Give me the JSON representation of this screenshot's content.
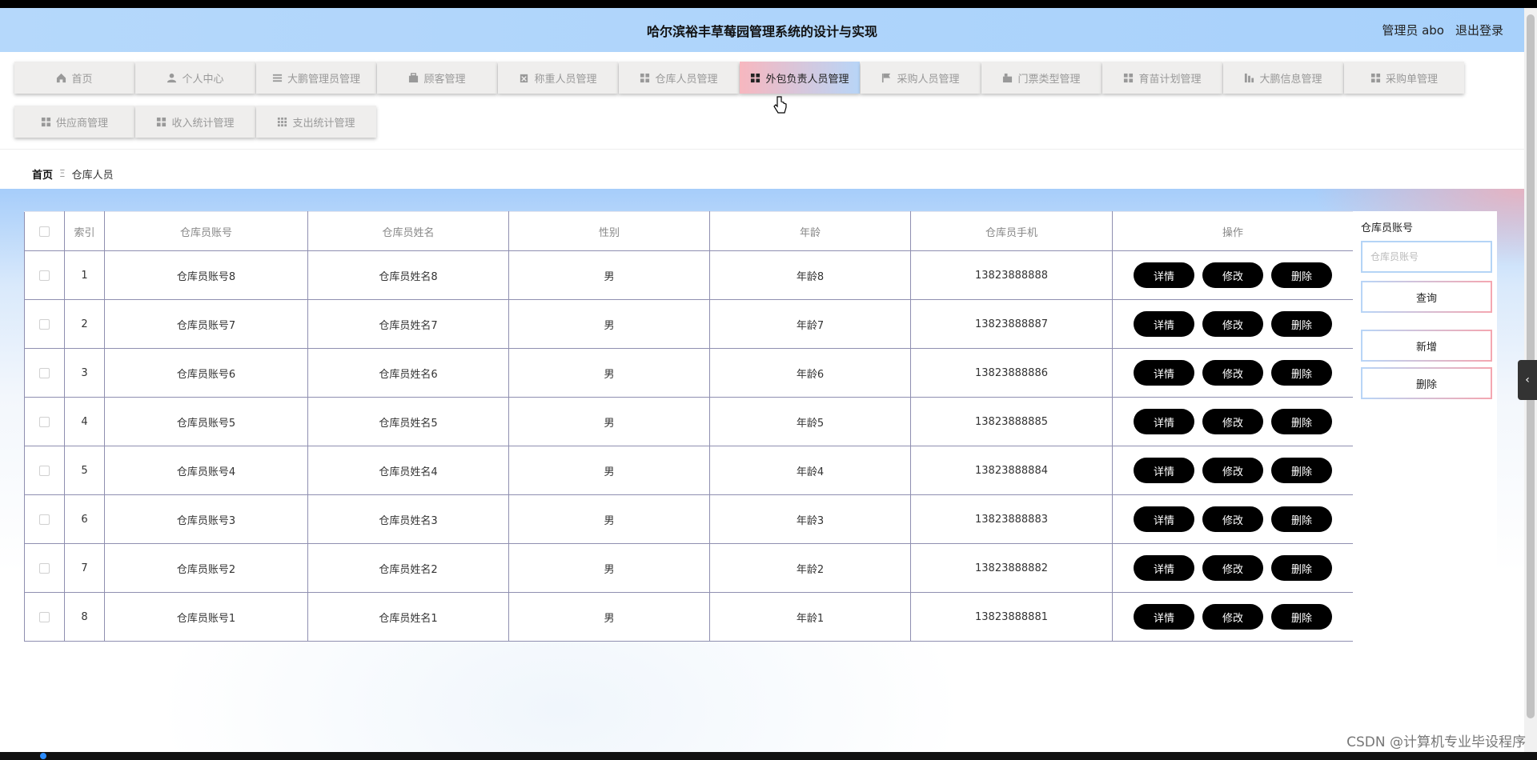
{
  "header": {
    "title": "哈尔滨裕丰草莓园管理系统的设计与实现",
    "role": "管理员 abo",
    "logout": "退出登录"
  },
  "nav": {
    "items": [
      {
        "label": "首页",
        "icon": "home-icon"
      },
      {
        "label": "个人中心",
        "icon": "user-icon"
      },
      {
        "label": "大鹏管理员管理",
        "icon": "list-icon"
      },
      {
        "label": "顾客管理",
        "icon": "briefcase-icon"
      },
      {
        "label": "称重人员管理",
        "icon": "clipboard-icon"
      },
      {
        "label": "仓库人员管理",
        "icon": "grid-icon"
      },
      {
        "label": "外包负责人员管理",
        "icon": "grid-icon",
        "active": true
      },
      {
        "label": "采购人员管理",
        "icon": "flag-icon"
      },
      {
        "label": "门票类型管理",
        "icon": "ticket-icon"
      },
      {
        "label": "育苗计划管理",
        "icon": "grid-icon"
      },
      {
        "label": "大鹏信息管理",
        "icon": "chart-icon"
      },
      {
        "label": "采购单管理",
        "icon": "grid-icon"
      },
      {
        "label": "供应商管理",
        "icon": "grid-icon"
      },
      {
        "label": "收入统计管理",
        "icon": "grid-icon"
      },
      {
        "label": "支出统计管理",
        "icon": "apps-icon"
      }
    ]
  },
  "breadcrumb": {
    "home": "首页",
    "separator": "Ξ",
    "current": "仓库人员"
  },
  "table": {
    "headers": [
      "索引",
      "仓库员账号",
      "仓库员姓名",
      "性别",
      "年龄",
      "仓库员手机",
      "操作"
    ],
    "actions": {
      "detail": "详情",
      "edit": "修改",
      "delete": "删除"
    },
    "rows": [
      {
        "index": "1",
        "account": "仓库员账号8",
        "name": "仓库员姓名8",
        "gender": "男",
        "age": "年龄8",
        "phone": "13823888888"
      },
      {
        "index": "2",
        "account": "仓库员账号7",
        "name": "仓库员姓名7",
        "gender": "男",
        "age": "年龄7",
        "phone": "13823888887"
      },
      {
        "index": "3",
        "account": "仓库员账号6",
        "name": "仓库员姓名6",
        "gender": "男",
        "age": "年龄6",
        "phone": "13823888886"
      },
      {
        "index": "4",
        "account": "仓库员账号5",
        "name": "仓库员姓名5",
        "gender": "男",
        "age": "年龄5",
        "phone": "13823888885"
      },
      {
        "index": "5",
        "account": "仓库员账号4",
        "name": "仓库员姓名4",
        "gender": "男",
        "age": "年龄4",
        "phone": "13823888884"
      },
      {
        "index": "6",
        "account": "仓库员账号3",
        "name": "仓库员姓名3",
        "gender": "男",
        "age": "年龄3",
        "phone": "13823888883"
      },
      {
        "index": "7",
        "account": "仓库员账号2",
        "name": "仓库员姓名2",
        "gender": "男",
        "age": "年龄2",
        "phone": "13823888882"
      },
      {
        "index": "8",
        "account": "仓库员账号1",
        "name": "仓库员姓名1",
        "gender": "男",
        "age": "年龄1",
        "phone": "13823888881"
      }
    ]
  },
  "search": {
    "label": "仓库员账号",
    "value": "",
    "placeholder": "仓库员账号",
    "search_label": "查询",
    "add_label": "新增",
    "delete_label": "删除"
  },
  "watermark": "CSDN @计算机专业毕设程序",
  "drawer_tab_glyph": "‹"
}
